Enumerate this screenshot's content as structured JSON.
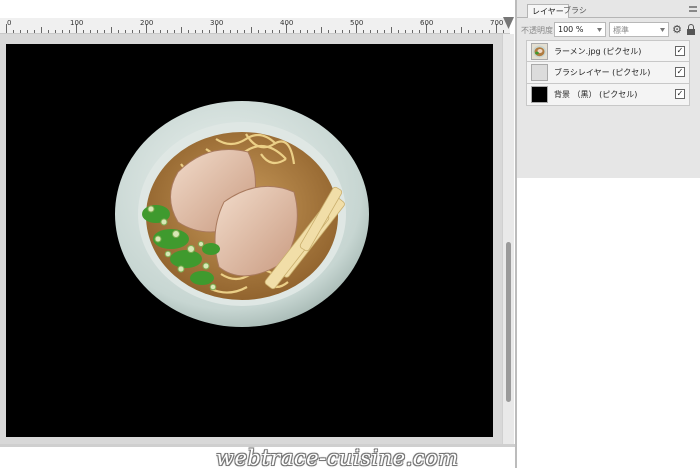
{
  "ruler": {
    "labels": [
      "0",
      "100",
      "200",
      "300",
      "400",
      "500",
      "600",
      "700"
    ]
  },
  "panel": {
    "tabs": [
      {
        "label": "レイヤー",
        "active": true
      },
      {
        "label": "ブラシ",
        "active": false
      }
    ],
    "opacity_label": "不透明度:",
    "opacity_value": "100 %",
    "blend_mode_value": "標準",
    "layers": [
      {
        "name": "ラーメン.jpg (ピクセル)",
        "thumb": "ramen-thumbnail",
        "visible": true,
        "check_mark": "✓"
      },
      {
        "name": "ブラシレイヤー (ピクセル)",
        "thumb": "blank-thumbnail",
        "visible": true,
        "check_mark": "✓"
      },
      {
        "name": "背景 （黒） (ピクセル)",
        "thumb": "black-thumbnail",
        "visible": true,
        "check_mark": "✓"
      }
    ]
  },
  "icons": {
    "gear": "gear-icon",
    "lock": "lock-icon",
    "panel_menu": "panel-menu-icon"
  },
  "colors": {
    "canvas_background": "#000000",
    "panel_background": "#e6e6e6",
    "workspace": "#d8d8d8"
  },
  "watermark": {
    "text": "webtrace-cuisine.com"
  }
}
